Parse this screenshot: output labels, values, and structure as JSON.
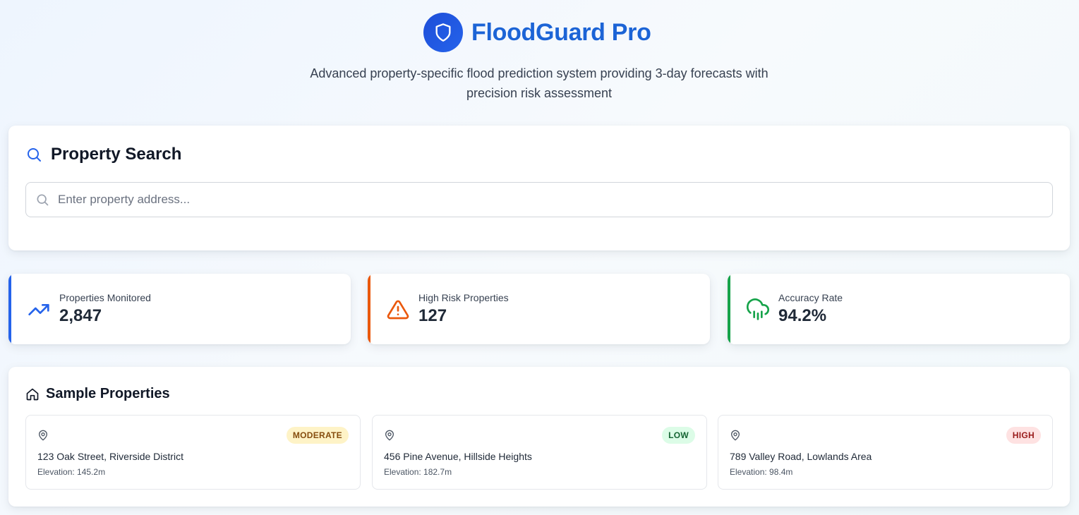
{
  "app": {
    "title": "FloodGuard Pro",
    "subtitle_line1": "Advanced property-specific flood prediction system providing 3-day forecasts with",
    "subtitle_line2": "precision risk assessment",
    "logo_icon": "shield-icon"
  },
  "search": {
    "heading": "Property Search",
    "placeholder": "Enter property address...",
    "value": ""
  },
  "stats": [
    {
      "label": "Properties Monitored",
      "value": "2,847",
      "icon": "trending-up-icon",
      "color": "#2563eb"
    },
    {
      "label": "High Risk Properties",
      "value": "127",
      "icon": "alert-triangle-icon",
      "color": "#ea580c"
    },
    {
      "label": "Accuracy Rate",
      "value": "94.2%",
      "icon": "cloud-rain-icon",
      "color": "#16a34a"
    }
  ],
  "properties_section": {
    "heading": "Sample Properties",
    "icon": "home-icon"
  },
  "properties": [
    {
      "address": "123 Oak Street, Riverside District",
      "elevation": "Elevation: 145.2m",
      "risk": "MODERATE",
      "badge_bg": "#fef3c7",
      "badge_fg": "#854d0e"
    },
    {
      "address": "456 Pine Avenue, Hillside Heights",
      "elevation": "Elevation: 182.7m",
      "risk": "LOW",
      "badge_bg": "#dcfce7",
      "badge_fg": "#166534"
    },
    {
      "address": "789 Valley Road, Lowlands Area",
      "elevation": "Elevation: 98.4m",
      "risk": "HIGH",
      "badge_bg": "#fee2e2",
      "badge_fg": "#991b1b"
    }
  ],
  "colors": {
    "brand": "#1c64d6",
    "accent_blue": "#2563eb",
    "accent_orange": "#ea580c",
    "accent_green": "#16a34a"
  }
}
